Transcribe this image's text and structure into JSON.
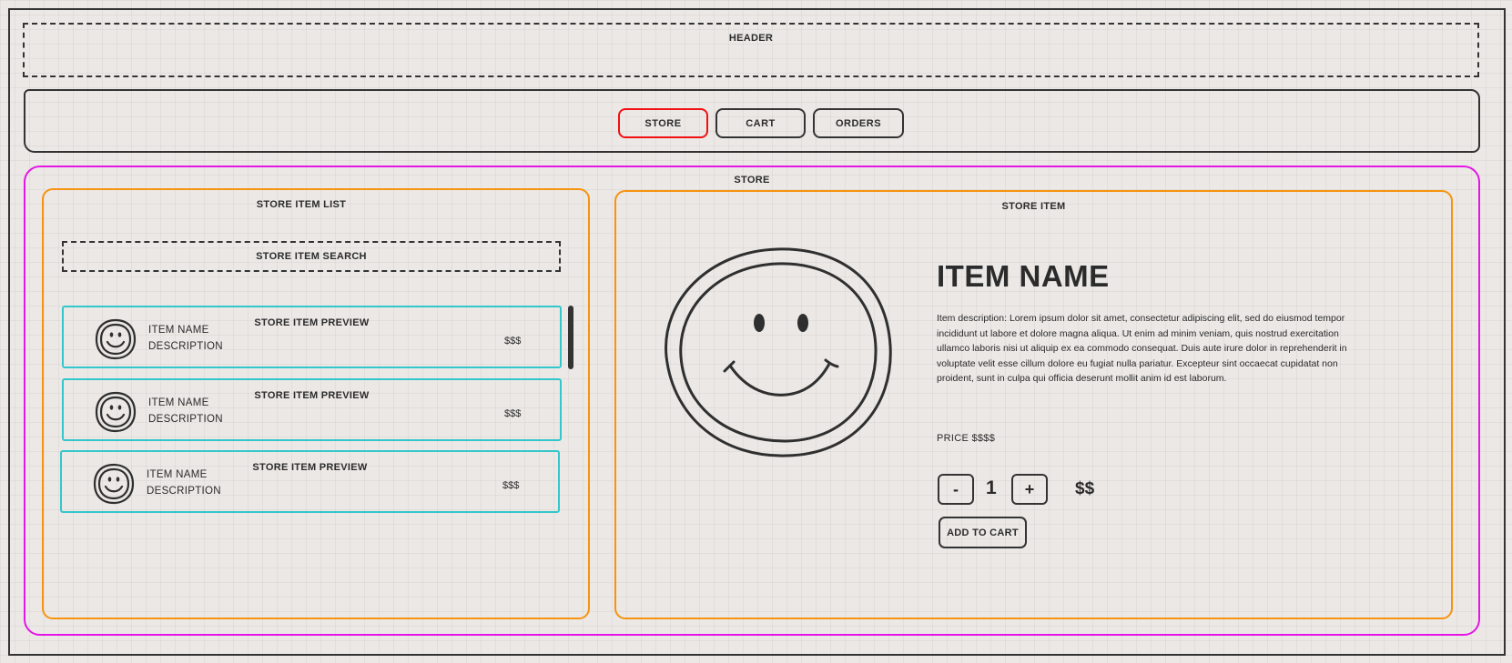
{
  "header": {
    "label": "HEADER"
  },
  "nav": {
    "store": "STORE",
    "cart": "CART",
    "orders": "ORDERS",
    "active_color": "#f01010"
  },
  "store": {
    "label": "STORE",
    "list": {
      "label": "STORE ITEM LIST",
      "search": "STORE ITEM SEARCH",
      "previews": [
        {
          "title": "STORE ITEM PREVIEW",
          "name": "ITEM NAME",
          "description": "DESCRIPTION",
          "price": "$$$",
          "icon": "smiley-icon"
        },
        {
          "title": "STORE ITEM PREVIEW",
          "name": "ITEM NAME",
          "description": "DESCRIPTION",
          "price": "$$$",
          "icon": "smiley-icon"
        },
        {
          "title": "STORE ITEM PREVIEW",
          "name": "ITEM NAME",
          "description": "DESCRIPTION",
          "price": "$$$",
          "icon": "smiley-icon"
        }
      ]
    },
    "item": {
      "label": "STORE ITEM",
      "name": "ITEM NAME",
      "description": "Item description: Lorem ipsum dolor sit amet, consectetur adipiscing elit, sed do eiusmod tempor incididunt ut labore et dolore magna aliqua. Ut enim ad minim veniam, quis nostrud exercitation ullamco laboris nisi ut aliquip ex ea commodo consequat. Duis aute irure dolor in reprehenderit in voluptate velit esse cillum dolore eu fugiat nulla pariatur. Excepteur sint occaecat cupidatat non proident, sunt in culpa qui officia deserunt mollit anim id est laborum.",
      "price": "PRICE $$$$",
      "minus": "-",
      "plus": "+",
      "quantity": "1",
      "subtotal": "$$",
      "add_to_cart": "ADD TO CART"
    }
  },
  "colors": {
    "store_region": "#e515e5",
    "panel": "#f7930e",
    "preview": "#33c7cc",
    "ink": "#333333"
  }
}
